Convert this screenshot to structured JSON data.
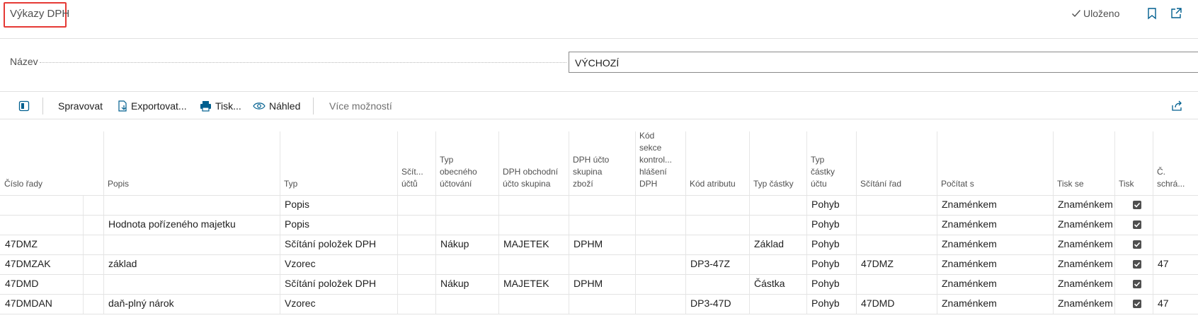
{
  "header": {
    "title": "Výkazy DPH",
    "saved_label": "Uloženo"
  },
  "form": {
    "name_label": "Název",
    "name_value": "VÝCHOZÍ"
  },
  "toolbar": {
    "manage": "Spravovat",
    "export": "Exportovat...",
    "print": "Tisk...",
    "preview": "Náhled",
    "more": "Více možností"
  },
  "table": {
    "columns": [
      [
        "Číslo řady"
      ],
      [
        ""
      ],
      [
        "Popis"
      ],
      [
        "Typ"
      ],
      [
        "Sčít...",
        "účtů"
      ],
      [
        "Typ",
        "obecného",
        "účtování"
      ],
      [
        "DPH obchodní",
        "účto skupina"
      ],
      [
        "DPH účto",
        "skupina",
        "zboží"
      ],
      [
        "Kód",
        "sekce",
        "kontrol...",
        "hlášení",
        "DPH"
      ],
      [
        "Kód atributu"
      ],
      [
        "Typ částky"
      ],
      [
        "Typ",
        "částky",
        "účtu"
      ],
      [
        "Sčítání řad"
      ],
      [
        "Počítat s"
      ],
      [
        "Tisk se"
      ],
      [
        "Tisk"
      ],
      [
        "Č.",
        "schrá..."
      ]
    ],
    "rows": [
      [
        "",
        "",
        "",
        "Popis",
        "",
        "",
        "",
        "",
        "",
        "",
        "",
        "Pohyb",
        "",
        "Znaménkem",
        "Znaménkem",
        "checked",
        ""
      ],
      [
        "",
        "",
        "Hodnota pořízeného majetku",
        "Popis",
        "",
        "",
        "",
        "",
        "",
        "",
        "",
        "Pohyb",
        "",
        "Znaménkem",
        "Znaménkem",
        "checked",
        ""
      ],
      [
        "47DMZ",
        "",
        "",
        "Sčítání položek DPH",
        "",
        "Nákup",
        "MAJETEK",
        "DPHM",
        "",
        "",
        "Základ",
        "Pohyb",
        "",
        "Znaménkem",
        "Znaménkem",
        "checked",
        ""
      ],
      [
        "47DMZAK",
        "",
        "základ",
        "Vzorec",
        "",
        "",
        "",
        "",
        "",
        "DP3-47Z",
        "",
        "Pohyb",
        "47DMZ",
        "Znaménkem",
        "Znaménkem",
        "checked",
        "47"
      ],
      [
        "47DMD",
        "",
        "",
        "Sčítání položek DPH",
        "",
        "Nákup",
        "MAJETEK",
        "DPHM",
        "",
        "",
        "Částka",
        "Pohyb",
        "",
        "Znaménkem",
        "Znaménkem",
        "checked",
        ""
      ],
      [
        "47DMDAN",
        "",
        "daň-plný nárok",
        "Vzorec",
        "",
        "",
        "",
        "",
        "",
        "DP3-47D",
        "",
        "Pohyb",
        "47DMD",
        "Znaménkem",
        "Znaménkem",
        "checked",
        "47"
      ]
    ]
  },
  "colors": {
    "accent": "#005f8f",
    "title_highlight": "#e53935",
    "text": "#212121",
    "muted": "#505050"
  },
  "icons": [
    "check-icon",
    "bookmark-icon",
    "open-new-window-icon",
    "factbox-icon",
    "export-icon",
    "print-icon",
    "eye-icon",
    "share-icon"
  ]
}
